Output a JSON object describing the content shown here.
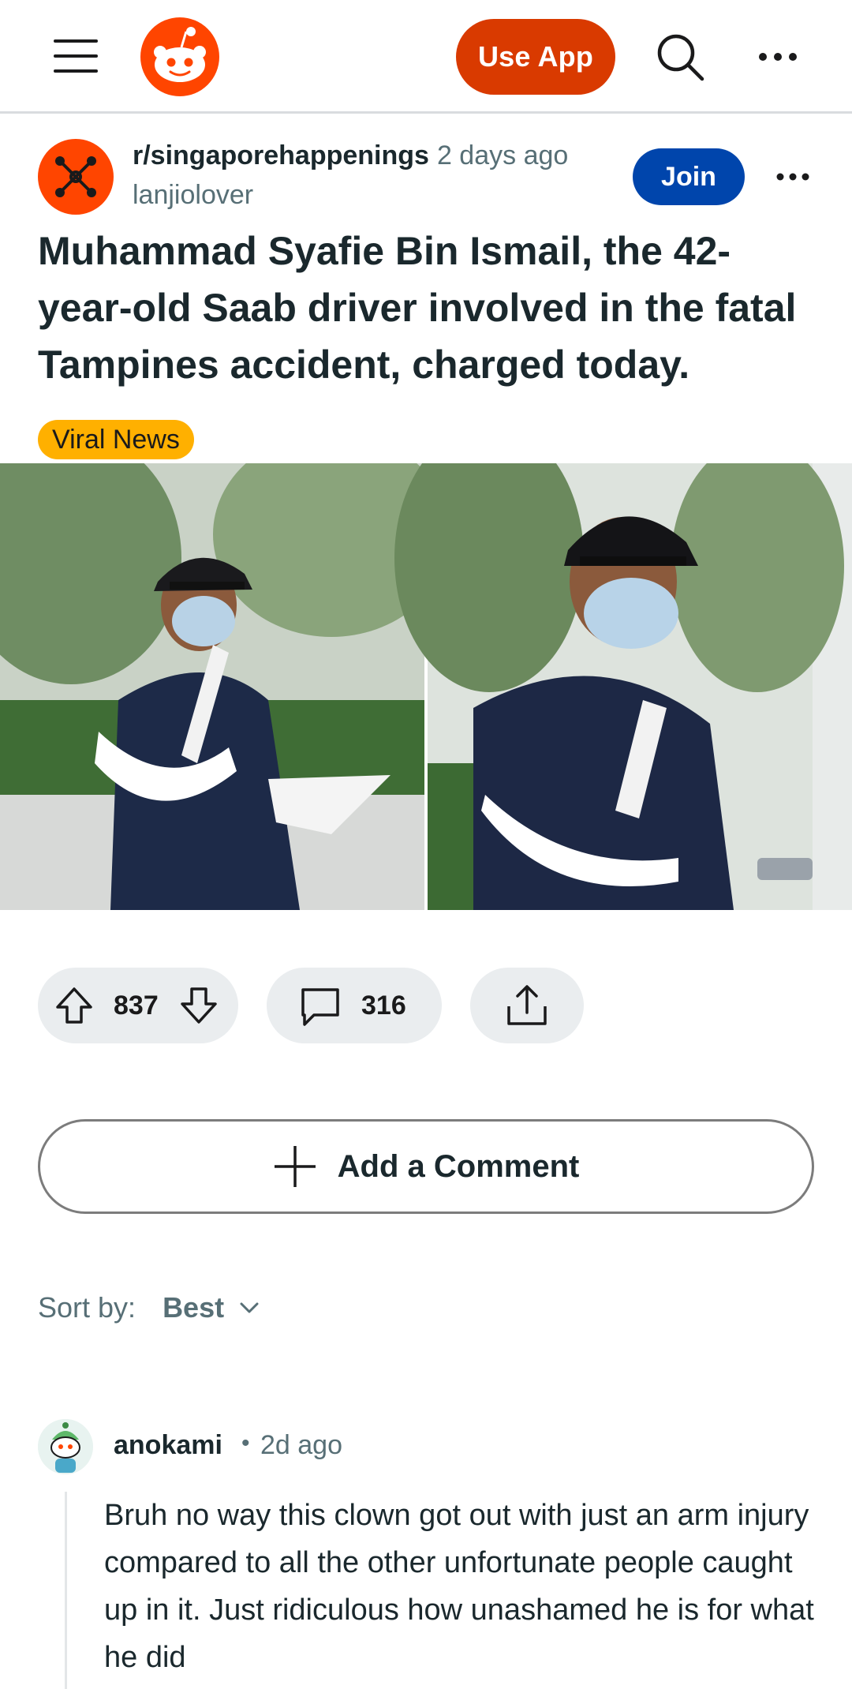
{
  "header": {
    "use_app_label": "Use App",
    "icons": [
      "menu-icon",
      "reddit-logo",
      "search-icon",
      "more-icon"
    ]
  },
  "post": {
    "subreddit": "r/singaporehappenings",
    "time": "2 days ago",
    "author": "lanjiolover",
    "join_label": "Join",
    "title": "Muhammad Syafie Bin Ismail, the 42-year-old Saab driver involved in the fatal Tampines accident, charged today.",
    "flair": "Viral News",
    "flair_color": "#ffb000",
    "accent_color": "#d93a00",
    "join_color": "#0045ac"
  },
  "actions": {
    "score": "837",
    "comments": "316",
    "add_comment_label": "Add a Comment"
  },
  "sort": {
    "label": "Sort by:",
    "value": "Best"
  },
  "comments": [
    {
      "author": "anokami",
      "separator": "•",
      "time": "2d ago",
      "body": "Bruh no way this clown got out with just an arm injury compared to all the other unfortunate people caught up in it. Just ridiculous how unashamed he is for what he did"
    }
  ]
}
